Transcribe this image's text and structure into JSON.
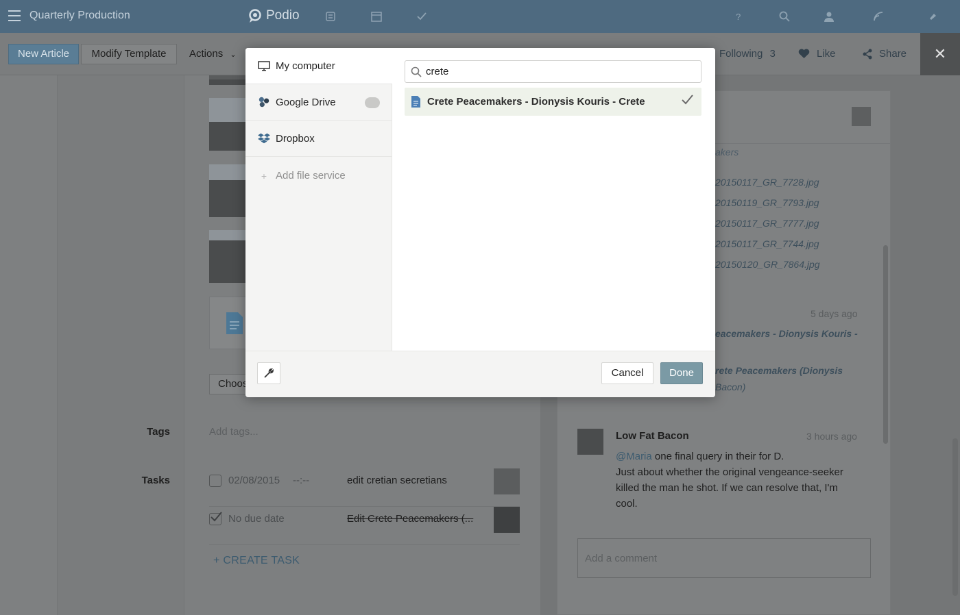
{
  "topbar": {
    "workspace": "Quarterly Production",
    "logo": "Podio",
    "icons": [
      "apps-icon",
      "calendar-icon",
      "tasks-icon",
      "help-icon",
      "search-icon",
      "contacts-icon",
      "activity-icon",
      "notifications-icon"
    ]
  },
  "toolbar": {
    "new_label": "New Article",
    "modify_label": "Modify Template",
    "actions_label": "Actions",
    "following_label": "Following",
    "following_count": "3",
    "like_label": "Like",
    "share_label": "Share"
  },
  "item": {
    "choose_label": "Choose",
    "tags_label": "Tags",
    "tags_placeholder": "Add tags...",
    "tasks_label": "Tasks",
    "tasks": [
      {
        "due": "02/08/2015",
        "time": "--:--",
        "title": "edit cretian secretians",
        "done": false
      },
      {
        "due": "No due date",
        "time": "",
        "title": "Edit Crete Peacemakers (...",
        "done": true
      }
    ],
    "create_task_label": "+ CREATE TASK"
  },
  "activity": {
    "partial_title": "akers",
    "files": [
      "20150117_GR_7728.jpg",
      "20150119_GR_7793.jpg",
      "20150117_GR_7777.jpg",
      "20150117_GR_7744.jpg",
      "20150120_GR_7864.jpg"
    ],
    "event_time": "5 days ago",
    "event_line1": "eacemakers - Dionysis Kouris -",
    "event_line2": "rete Peacemakers (Dionysis",
    "event_line3": "Bacon)",
    "comment": {
      "author": "Low Fat Bacon",
      "time": "3 hours ago",
      "mention": "@Maria",
      "text1": " one final query in their for D.",
      "text2": "Just about whether the original vengeance-seeker killed the man he shot. If we can resolve that, I'm cool."
    },
    "comment_placeholder": "Add a comment"
  },
  "modal": {
    "services": [
      {
        "label": "My computer",
        "icon": "monitor-icon",
        "active": true
      },
      {
        "label": "Google Drive",
        "icon": "google-drive-icon",
        "active": false
      },
      {
        "label": "Dropbox",
        "icon": "dropbox-icon",
        "active": false
      }
    ],
    "add_service_label": "Add file service",
    "search_value": "crete",
    "result_title": "Crete Peacemakers - Dionysis Kouris - Crete",
    "cancel_label": "Cancel",
    "done_label": "Done"
  }
}
